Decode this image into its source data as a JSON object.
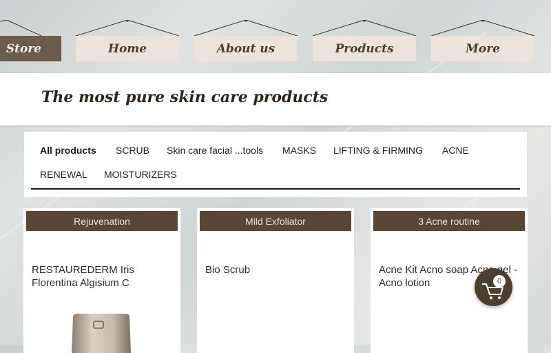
{
  "nav": {
    "items": [
      {
        "label": "Store",
        "active": true
      },
      {
        "label": "Home",
        "active": false
      },
      {
        "label": "About us",
        "active": false
      },
      {
        "label": "Products",
        "active": false
      },
      {
        "label": "More",
        "active": false
      }
    ]
  },
  "header": {
    "title": "The most pure skin care products"
  },
  "filters": {
    "items": [
      {
        "label": "All products",
        "active": true
      },
      {
        "label": "SCRUB",
        "active": false
      },
      {
        "label": "Skin care facial ...tools",
        "active": false
      },
      {
        "label": "MASKS",
        "active": false
      },
      {
        "label": "LIFTING & FIRMING",
        "active": false
      },
      {
        "label": "ACNE",
        "active": false
      },
      {
        "label": "RENEWAL",
        "active": false
      },
      {
        "label": "MOISTURIZERS",
        "active": false
      }
    ]
  },
  "products": [
    {
      "ribbon": "Rejuvenation",
      "name": "RESTAUREDERM  Iris Florentina Algisium C"
    },
    {
      "ribbon": "Mild Exfoliator",
      "name": "Bio Scrub"
    },
    {
      "ribbon": "3 Acne routine",
      "name": "Acne Kit  Acno soap Acno gel - Acno lotion"
    }
  ],
  "cart": {
    "count": "0",
    "icon": "cart-icon"
  },
  "colors": {
    "ribbon": "#574734",
    "sign": "#ece3da",
    "sign_active": "#6a5c4f",
    "cart": "#4e3e2d"
  }
}
